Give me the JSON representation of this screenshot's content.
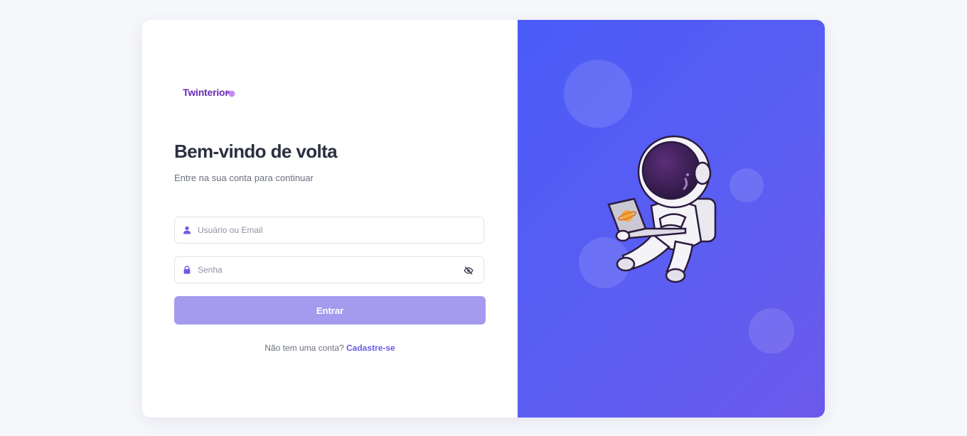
{
  "brand": {
    "name": "Twinterior"
  },
  "login": {
    "title": "Bem-vindo de volta",
    "subtitle": "Entre na sua conta para continuar",
    "username_placeholder": "Usuário ou Email",
    "password_placeholder": "Senha",
    "submit_label": "Entrar",
    "signup_prompt": "Não tem uma conta?",
    "signup_link": "Cadastre-se"
  },
  "icons": {
    "username": "user-icon",
    "password": "lock-icon",
    "toggle_visibility": "eye-off-icon",
    "illustration": "astronaut-with-laptop-illustration"
  },
  "colors": {
    "brand": "#6a2bb0",
    "accent": "#6a5be8",
    "button": "#a59bee",
    "panel_start": "#4a5bf7",
    "panel_end": "#6b59ea",
    "title": "#2b3040"
  }
}
